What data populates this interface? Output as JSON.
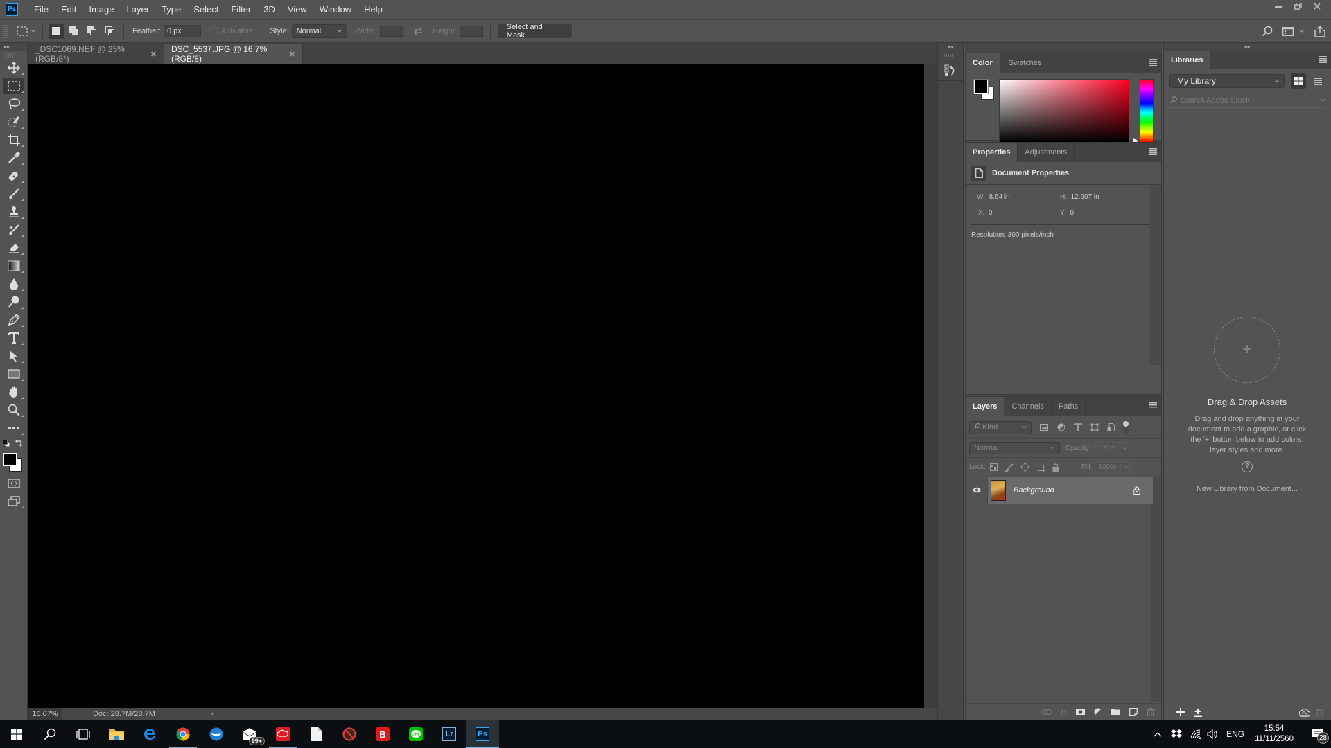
{
  "app": {
    "name": "Photoshop",
    "logo_text": "Ps"
  },
  "menu": [
    "File",
    "Edit",
    "Image",
    "Layer",
    "Type",
    "Select",
    "Filter",
    "3D",
    "View",
    "Window",
    "Help"
  ],
  "window_controls": {
    "minimize": "minimize-icon",
    "restore": "restore-icon",
    "close": "close-icon"
  },
  "options_bar": {
    "feather_label": "Feather:",
    "feather_value": "0 px",
    "antialias_label": "Anti-alias",
    "style_label": "Style:",
    "style_value": "Normal",
    "width_label": "Width:",
    "height_label": "Height:",
    "select_mask_label": "Select and Mask..."
  },
  "doc_tabs": [
    {
      "label": "_DSC1069.NEF @ 25% (RGB/8*)",
      "active": false
    },
    {
      "label": "DSC_5537.JPG @ 16.7% (RGB/8)",
      "active": true
    }
  ],
  "status_bar": {
    "zoom": "16.67%",
    "doc_info": "Doc: 28.7M/28.7M",
    "arrow": "›"
  },
  "toolbar": {
    "tools": [
      "move",
      "rectangular-marquee",
      "lasso",
      "quick-selection",
      "crop",
      "eyedropper",
      "spot-healing-brush",
      "brush",
      "clone-stamp",
      "history-brush",
      "eraser",
      "gradient",
      "blur",
      "dodge",
      "pen",
      "type",
      "path-selection",
      "rectangle",
      "hand",
      "zoom",
      "edit-toolbar"
    ],
    "active_tool": "rectangular-marquee",
    "foreground_color": "#000000",
    "background_color": "#ffffff"
  },
  "color_panel": {
    "tabs": [
      "Color",
      "Swatches"
    ],
    "active_tab": "Color",
    "hue_color": "#ff0020"
  },
  "properties_panel": {
    "tabs": [
      "Properties",
      "Adjustments"
    ],
    "active_tab": "Properties",
    "title": "Document Properties",
    "w_label": "W:",
    "w_value": "8.64 in",
    "h_label": "H:",
    "h_value": "12.907 in",
    "x_label": "X:",
    "x_value": "0",
    "y_label": "Y:",
    "y_value": "0",
    "resolution": "Resolution: 300 pixels/inch"
  },
  "layers_panel": {
    "tabs": [
      "Layers",
      "Channels",
      "Paths"
    ],
    "active_tab": "Layers",
    "filter_placeholder": "Kind",
    "blend_mode": "Normal",
    "opacity_label": "Opacity:",
    "opacity_value": "100%",
    "lock_label": "Lock:",
    "fill_label": "Fill:",
    "fill_value": "100%",
    "layers": [
      {
        "name": "Background",
        "visible": true,
        "locked": true
      }
    ]
  },
  "libraries_panel": {
    "tab": "Libraries",
    "library_select": "My Library",
    "search_placeholder": "Search Adobe Stock",
    "empty_title": "Drag & Drop Assets",
    "empty_text": "Drag and drop anything in your document to add a graphic, or click the '+' button below to add colors, layer styles and more.",
    "help_icon": "?",
    "new_library_link": "New Library from Document..."
  },
  "taskbar": {
    "apps": [
      {
        "name": "file-explorer",
        "running": false
      },
      {
        "name": "edge",
        "running": false
      },
      {
        "name": "chrome",
        "running": true
      },
      {
        "name": "thunderbird",
        "running": false
      },
      {
        "name": "mail",
        "running": false,
        "badge": "99+"
      },
      {
        "name": "creative-cloud",
        "running": true
      },
      {
        "name": "notepad",
        "running": false
      },
      {
        "name": "blocked-app",
        "running": false
      },
      {
        "name": "bitdefender",
        "running": false
      },
      {
        "name": "line",
        "running": false
      },
      {
        "name": "lightroom",
        "running": false,
        "label": "Lr"
      },
      {
        "name": "photoshop",
        "running": true,
        "active": true,
        "label": "Ps"
      }
    ],
    "tray": {
      "language": "ENG",
      "time": "15:54",
      "date": "11/11/2560",
      "notifications": "28"
    }
  }
}
